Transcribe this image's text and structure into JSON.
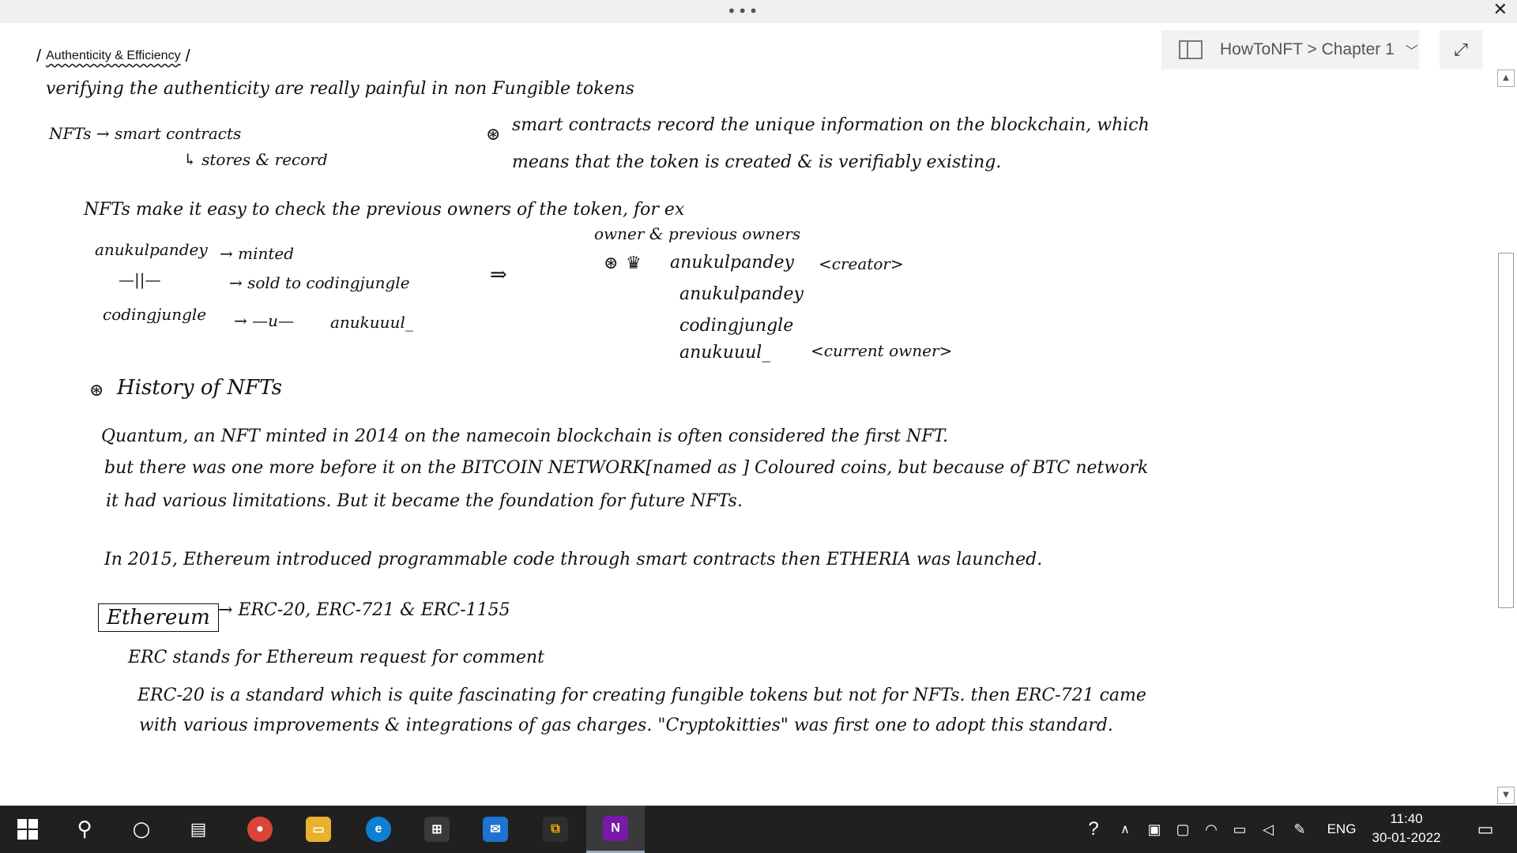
{
  "window": {
    "more_glyph": "•••",
    "close_glyph": "✕"
  },
  "page": {
    "title": "Authenticity & Efficiency"
  },
  "notebook": {
    "breadcrumb": "HowToNFT > Chapter 1",
    "chevron": "﹀",
    "expand_glyph": "⤢"
  },
  "notes": {
    "line1": "verifying the authenticity are really painful in non Fungible tokens",
    "nft_smart": "NFTs → smart contracts",
    "stores_record": "↳ stores & record",
    "star_glyph": "⊛",
    "smart_record_1": "smart contracts record the unique information on the blockchain, which",
    "smart_record_2": "means that the token is created & is verifiably existing.",
    "owners_intro": "NFTs make it easy to check the previous owners of the token, for ex",
    "owner_prev": "owner & previous owners",
    "row1_name": "anukulpandey",
    "row1_action": "→ minted",
    "row2_name": "—||—",
    "row2_action": "→ sold to codingjungle",
    "row3_name": "codingjungle",
    "row3_action": "→ —u—",
    "row3_target": "anukuuul_",
    "implies": "⇒",
    "crown": "♛",
    "list_1": "anukulpandey",
    "list_1_tag": "<creator>",
    "list_2": "anukulpandey",
    "list_3": "codingjungle",
    "list_4": "anukuuul_",
    "list_4_tag": "<current owner>",
    "history_heading": "History of NFTs",
    "hist_1": "Quantum, an NFT minted in 2014 on the namecoin blockchain is often considered the first NFT.",
    "hist_2": "but there was one more before it on the BITCOIN NETWORK[named as ] Coloured coins, but because of BTC network",
    "hist_3": "it had various limitations. But it became the foundation for future NFTs.",
    "eth_2015": "In 2015, Ethereum introduced programmable code through smart contracts then ETHERIA was launched.",
    "ethereum_box": "Ethereum",
    "erc_list": "→ ERC-20, ERC-721 & ERC-1155",
    "erc_stands": "ERC stands for Ethereum request for comment",
    "erc_para_1": "ERC-20 is a standard which is quite fascinating for creating fungible tokens but not for NFTs. then ERC-721 came",
    "erc_para_2": "with various improvements & integrations of gas charges. \"Cryptokitties\" was first one to adopt this standard."
  },
  "taskbar": {
    "language": "ENG",
    "time": "11:40",
    "date": "30-01-2022",
    "onenote_letter": "N"
  },
  "colors": {
    "taskbar": "#202020",
    "onenote": "#7719aa",
    "chrome": "#db4437",
    "edge": "#0f7fd4"
  }
}
